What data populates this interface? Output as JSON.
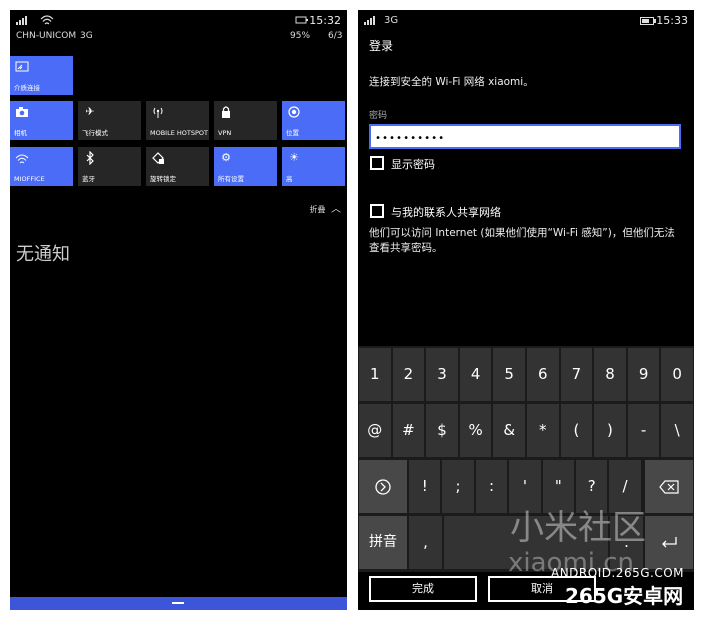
{
  "left": {
    "status": {
      "clock": "15:32",
      "carrier": "CHN-UNICOM",
      "network": "3G",
      "battery": "95%",
      "date": "6/3"
    },
    "tiles": [
      {
        "label": "介质连接",
        "icon": "media-connect-icon",
        "state": "on"
      },
      {
        "label": "相机",
        "icon": "camera-icon",
        "state": "on"
      },
      {
        "label": "飞行模式",
        "icon": "airplane-icon",
        "state": "off"
      },
      {
        "label": "MOBILE HOTSPOT",
        "icon": "hotspot-icon",
        "state": "off"
      },
      {
        "label": "VPN",
        "icon": "lock-icon",
        "state": "off"
      },
      {
        "label": "位置",
        "icon": "location-icon",
        "state": "on"
      },
      {
        "label": "MIOFFICE",
        "icon": "wifi-icon",
        "state": "on"
      },
      {
        "label": "蓝牙",
        "icon": "bluetooth-icon",
        "state": "off"
      },
      {
        "label": "旋转锁定",
        "icon": "rotation-lock-icon",
        "state": "off"
      },
      {
        "label": "所有设置",
        "icon": "gear-icon",
        "state": "on"
      },
      {
        "label": "高",
        "icon": "brightness-icon",
        "state": "on"
      }
    ],
    "collapse_label": "折叠",
    "no_notifications": "无通知"
  },
  "right": {
    "status": {
      "clock": "15:33",
      "network": "3G"
    },
    "title": "登录",
    "connect_text": "连接到安全的 Wi-Fi 网络 xiaomi。",
    "password_label": "密码",
    "password_value": "••••••••••",
    "show_password_label": "显示密码",
    "share_label": "与我的联系人共享网络",
    "share_desc": "他们可以访问 Internet (如果他们使用“Wi-Fi 感知”)，但他们无法查看共享密码。",
    "keyboard": {
      "row1": [
        "1",
        "2",
        "3",
        "4",
        "5",
        "6",
        "7",
        "8",
        "9",
        "0"
      ],
      "row2": [
        "@",
        "#",
        "$",
        "%",
        "&",
        "*",
        "(",
        ")",
        "-",
        "\\"
      ],
      "row3": [
        "!",
        ";",
        ":",
        "'",
        "\"",
        "?",
        "/"
      ],
      "pinyin_label": "拼音",
      "comma": ",",
      "period": "."
    },
    "done_label": "完成",
    "cancel_label": "取消"
  },
  "watermark": {
    "mi_community": "小米社区",
    "domain": "xiaomi.cn",
    "site_en": "ANDROID.265G.COM",
    "site_cn": "265G安卓网"
  },
  "colors": {
    "accent": "#4a6cf7",
    "tile_off": "#262626",
    "key": "#333333"
  }
}
